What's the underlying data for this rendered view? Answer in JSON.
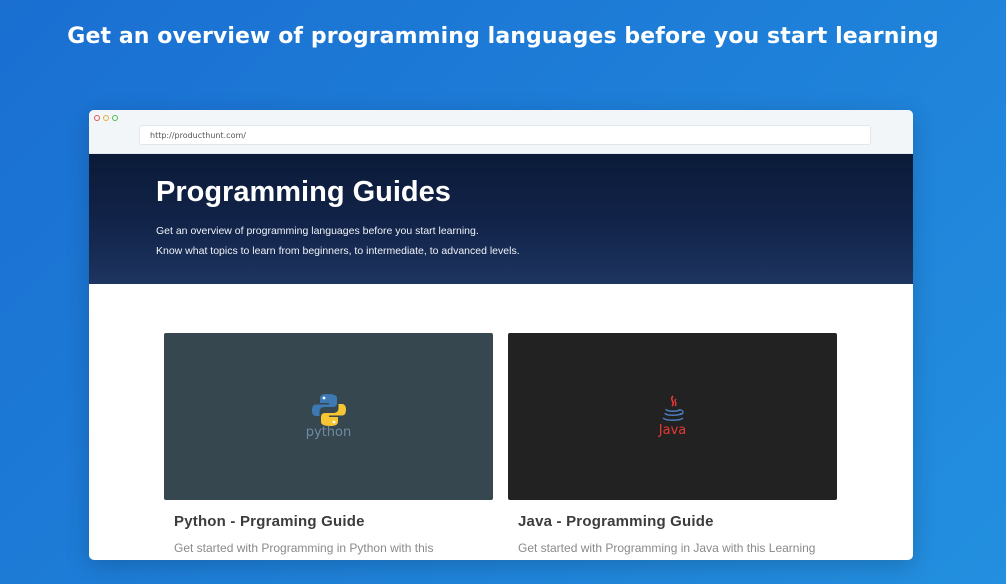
{
  "headline": "Get an overview of programming languages before you start learning",
  "browser": {
    "url": "http://producthunt.com/"
  },
  "hero": {
    "title": "Programming Guides",
    "subtitle_line1": "Get an overview of programming languages before you start learning.",
    "subtitle_line2": "Know what topics to learn from beginners, to intermediate, to advanced levels."
  },
  "cards": [
    {
      "title": "Python - Prgraming Guide",
      "description": "Get started with Programming in Python with this Learning Python",
      "logo_label": "python",
      "logo_icon": "python-logo-icon",
      "bg_color": "#37474f"
    },
    {
      "title": "Java - Programming Guide",
      "description": "Get started with Programming in Java with this Learning Path",
      "logo_label": "Java",
      "logo_icon": "java-logo-icon",
      "bg_color": "#222222"
    }
  ],
  "colors": {
    "background": "#1e7fd8",
    "hero_bg": "#12244a",
    "java_red": "#e53935",
    "python_blue": "#3d7ab4",
    "python_yellow": "#f7c531"
  }
}
